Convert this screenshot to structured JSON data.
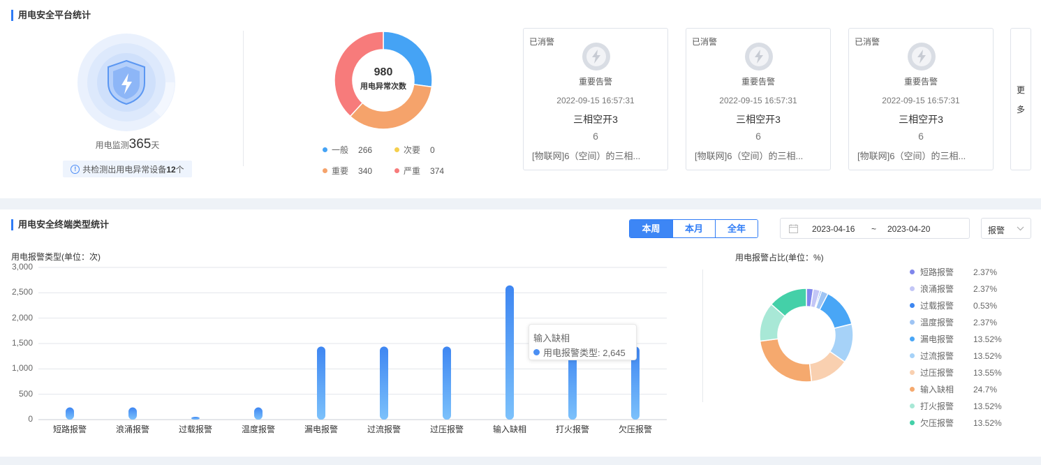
{
  "top": {
    "title": "用电安全平台统计",
    "monitor_prefix": "用电监测",
    "monitor_days": "365",
    "monitor_suffix": "天",
    "notice_prefix": "共检测出用电异常设备",
    "notice_count": "12",
    "notice_suffix": "个"
  },
  "donut": {
    "total": "980",
    "label": "用电异常次数",
    "legend": [
      {
        "name": "一般",
        "value": "266",
        "color": "#45a3f5"
      },
      {
        "name": "次要",
        "value": "0",
        "color": "#f5cf4d"
      },
      {
        "name": "重要",
        "value": "340",
        "color": "#f5a36b"
      },
      {
        "name": "严重",
        "value": "374",
        "color": "#f77b7b"
      }
    ]
  },
  "alerts": [
    {
      "status": "已消警",
      "level": "重要告警",
      "time": "2022-09-15 16:57:31",
      "name": "三相空开3",
      "count": "6",
      "desc": "[物联网]6（空间）的三相..."
    },
    {
      "status": "已消警",
      "level": "重要告警",
      "time": "2022-09-15 16:57:31",
      "name": "三相空开3",
      "count": "6",
      "desc": "[物联网]6（空间）的三相..."
    },
    {
      "status": "已消警",
      "level": "重要告警",
      "time": "2022-09-15 16:57:31",
      "name": "三相空开3",
      "count": "6",
      "desc": "[物联网]6（空间）的三相..."
    }
  ],
  "more": {
    "line1": "更",
    "line2": "多"
  },
  "bottom": {
    "title": "用电安全终端类型统计",
    "tabs": [
      {
        "label": "本周",
        "active": true
      },
      {
        "label": "本月",
        "active": false
      },
      {
        "label": "全年",
        "active": false
      }
    ],
    "date_start": "2023-04-16",
    "date_sep": "~",
    "date_end": "2023-04-20",
    "select_value": "报警"
  },
  "chart_data": [
    {
      "type": "bar",
      "title": "用电报警类型(单位：次)",
      "categories": [
        "短路报警",
        "浪涌报警",
        "过载报警",
        "温度报警",
        "漏电报警",
        "过流报警",
        "过压报警",
        "输入缺相",
        "打火报警",
        "欠压报警"
      ],
      "series": [
        {
          "name": "用电报警类型",
          "values": [
            240,
            240,
            55,
            240,
            1440,
            1440,
            1440,
            2645,
            1440,
            1440
          ]
        }
      ],
      "ylim": [
        0,
        3000
      ],
      "yticks": [
        "0",
        "500",
        "1,000",
        "1,500",
        "2,000",
        "2,500",
        "3,000"
      ],
      "grid": true,
      "tooltip": {
        "category": "输入缺相",
        "series": "用电报警类型",
        "value": "2,645"
      }
    },
    {
      "type": "pie",
      "title": "用电报警占比(单位：%)",
      "slices": [
        {
          "name": "短路报警",
          "value": 2.37,
          "label": "2.37%",
          "color": "#7f86ec"
        },
        {
          "name": "浪涌报警",
          "value": 2.37,
          "label": "2.37%",
          "color": "#c3c6f6"
        },
        {
          "name": "过载报警",
          "value": 0.53,
          "label": "0.53%",
          "color": "#3d86f0"
        },
        {
          "name": "温度报警",
          "value": 2.37,
          "label": "2.37%",
          "color": "#9ec4f4"
        },
        {
          "name": "漏电报警",
          "value": 13.52,
          "label": "13.52%",
          "color": "#49a6f6"
        },
        {
          "name": "过流报警",
          "value": 13.52,
          "label": "13.52%",
          "color": "#a6d2f8"
        },
        {
          "name": "过压报警",
          "value": 13.55,
          "label": "13.55%",
          "color": "#f9d0b0"
        },
        {
          "name": "输入缺相",
          "value": 24.7,
          "label": "24.7%",
          "color": "#f5a96e"
        },
        {
          "name": "打火报警",
          "value": 13.52,
          "label": "13.52%",
          "color": "#a8e8d6"
        },
        {
          "name": "欠压报警",
          "value": 13.52,
          "label": "13.52%",
          "color": "#44d0a8"
        }
      ]
    }
  ]
}
